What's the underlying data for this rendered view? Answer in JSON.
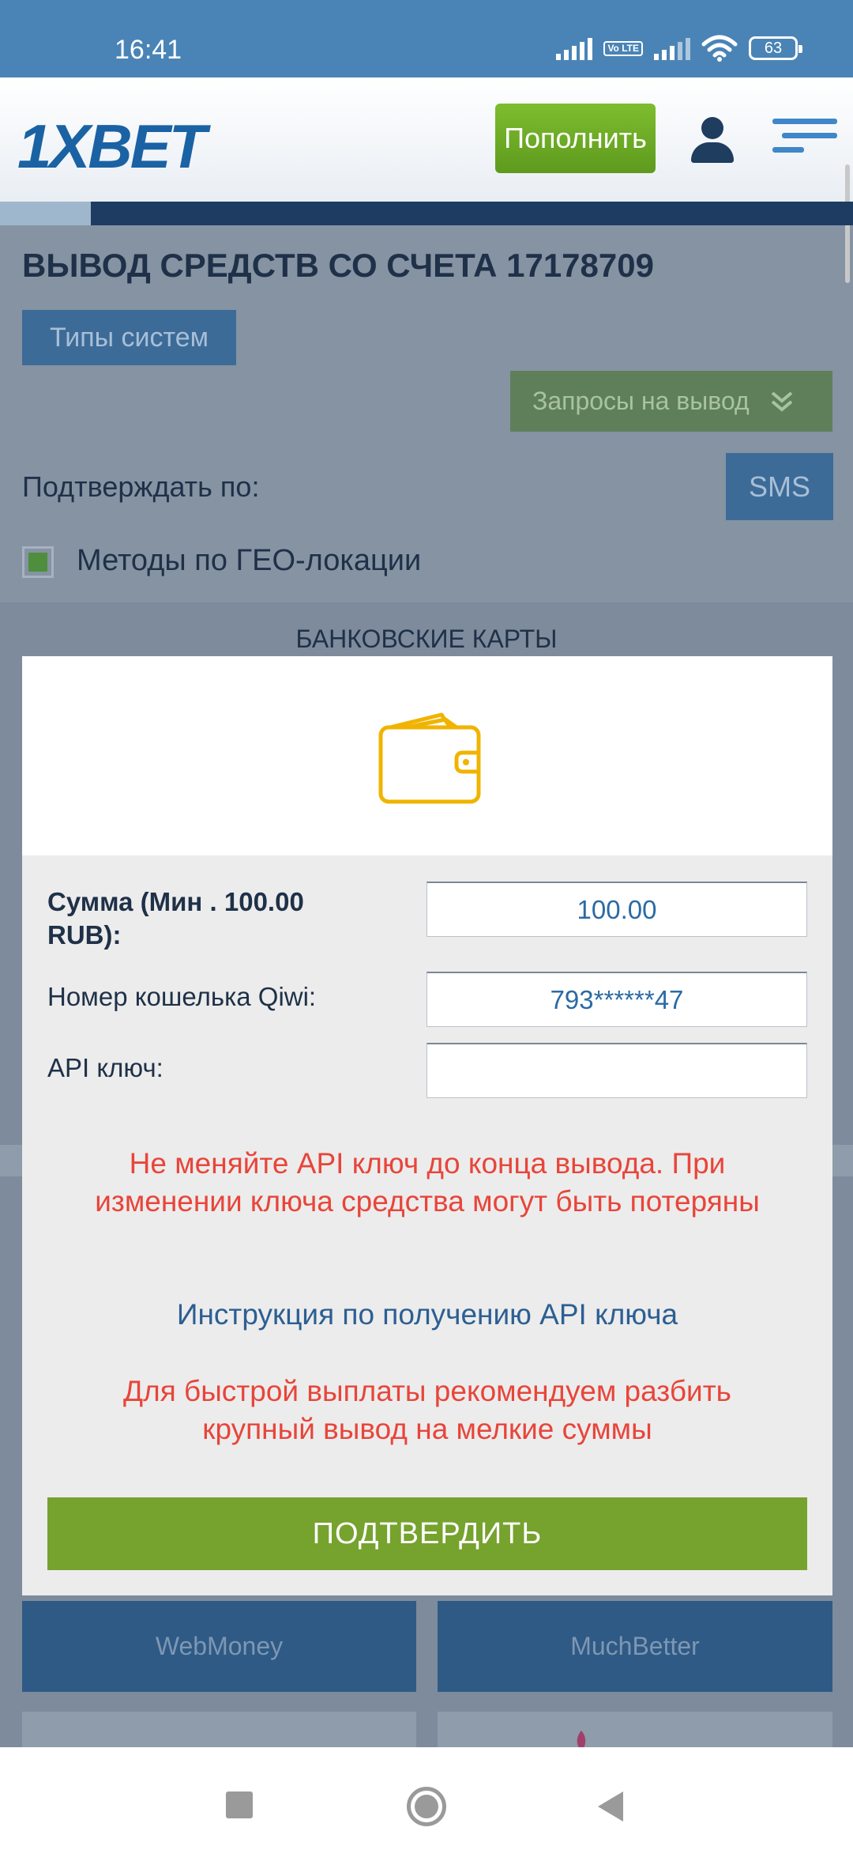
{
  "status_bar": {
    "time": "16:41",
    "volte": "Vo LTE",
    "battery": "63"
  },
  "header": {
    "logo": "1XBET",
    "deposit_label": "Пополнить"
  },
  "page": {
    "title": "ВЫВОД СРЕДСТВ СО СЧЕТА 17178709",
    "system_types_label": "Типы систем",
    "withdraw_requests_label": "Запросы на вывод",
    "confirm_by_label": "Подтверждать по:",
    "sms_label": "SMS",
    "geo_methods_label": "Методы по ГЕО-локации",
    "geo_methods_checked": true,
    "section_title": "БАНКОВСКИЕ КАРТЫ",
    "payment_methods": [
      "WebMoney",
      "MuchBetter"
    ]
  },
  "modal": {
    "amount_label": "Сумма (Мин . 100.00 RUB):",
    "amount_value": "100.00",
    "wallet_label": "Номер кошелька Qiwi:",
    "wallet_value": "793******47",
    "api_key_label": "API ключ:",
    "api_key_value": "",
    "warning_api": "Не меняйте API ключ до конца вывода. При изменении ключа средства могут быть потеряны",
    "instruction_link": "Инструкция по получению API ключа",
    "warning_split": "Для быстрой выплаты рекомендуем разбить крупный вывод на мелкие суммы",
    "confirm_label": "ПОДТВЕРДИТЬ"
  },
  "colors": {
    "accent_blue": "#1a62a3",
    "deposit_green": "#6aa823",
    "confirm_green": "#76a22e",
    "warning_red": "#e8453a",
    "wallet_icon": "#f0b400"
  }
}
